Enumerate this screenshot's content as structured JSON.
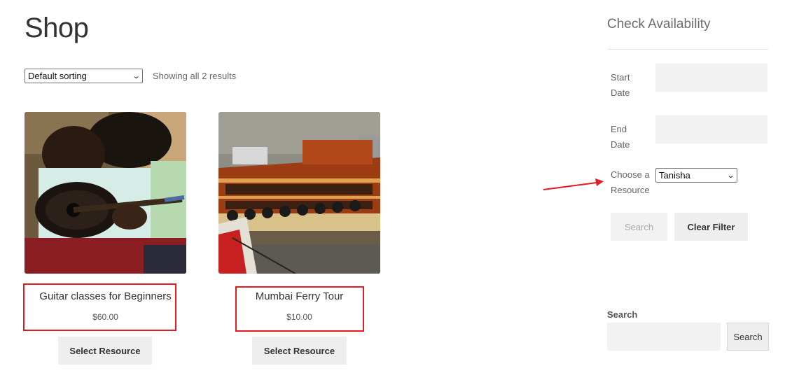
{
  "main": {
    "title": "Shop",
    "sorting": {
      "selected": "Default sorting"
    },
    "result_count": "Showing all 2 results",
    "products": [
      {
        "title": "Guitar classes for Beginners",
        "price": "$60.00",
        "button": "Select Resource"
      },
      {
        "title": "Mumbai Ferry Tour",
        "price": "$10.00",
        "button": "Select Resource"
      }
    ]
  },
  "sidebar": {
    "availability": {
      "title": "Check Availability",
      "start_date_label": "Start Date",
      "end_date_label": "End Date",
      "resource_label": "Choose a Resource",
      "resource_selected": "Tanisha",
      "search_button": "Search",
      "clear_button": "Clear Filter"
    },
    "search": {
      "label": "Search",
      "button": "Search"
    }
  },
  "colors": {
    "highlight": "#e31b23",
    "button_bg": "#eeeeee",
    "input_bg": "#f2f2f2"
  }
}
